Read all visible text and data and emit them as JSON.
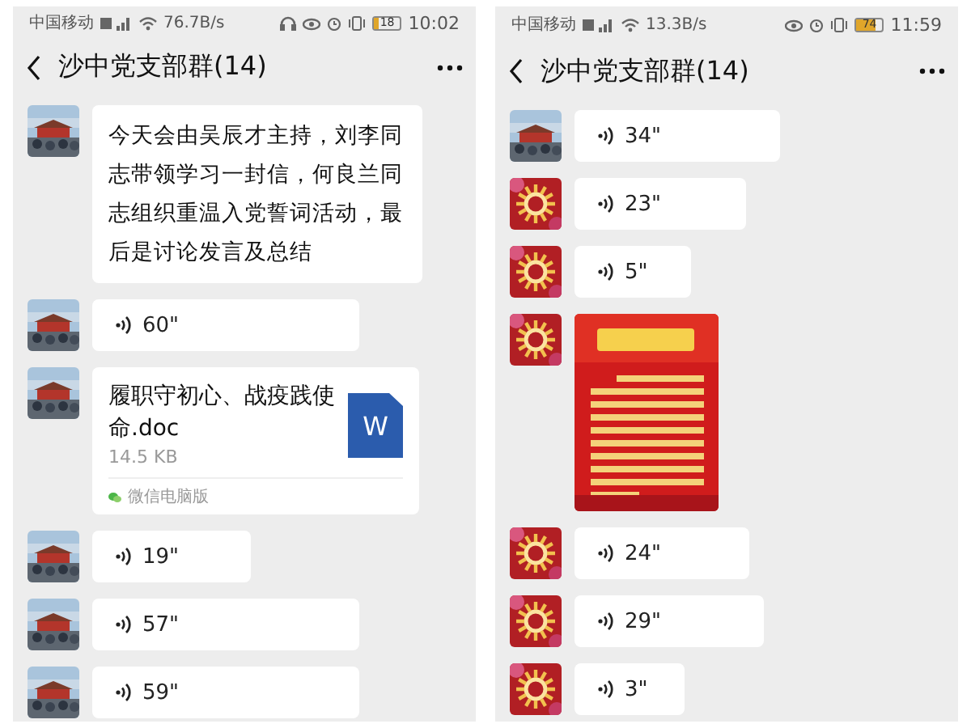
{
  "phones": [
    {
      "status_bar": {
        "carrier": "中国移动",
        "speed": "76.7B/s",
        "headset": true,
        "battery": "18",
        "time": "10:02"
      },
      "header": {
        "title": "沙中党支部群(14)"
      },
      "messages": [
        {
          "kind": "text",
          "avatar": {
            "kind": "gate"
          },
          "text": "今天会由吴辰才主持，刘李同志带领学习一封信，何良兰同志组织重温入党誓词活动，最后是讨论发言及总结"
        },
        {
          "kind": "voice",
          "avatar": {
            "kind": "gate"
          },
          "duration": "60\""
        },
        {
          "kind": "file",
          "avatar": {
            "kind": "gate"
          },
          "name": "履职守初心、战疫践使命.doc",
          "size": "14.5 KB",
          "icon_letter": "W",
          "source": "微信电脑版"
        },
        {
          "kind": "voice",
          "avatar": {
            "kind": "gate"
          },
          "duration": "19\""
        },
        {
          "kind": "voice",
          "avatar": {
            "kind": "gate"
          },
          "duration": "57\""
        },
        {
          "kind": "voice",
          "avatar": {
            "kind": "gate"
          },
          "duration": "59\""
        }
      ]
    },
    {
      "status_bar": {
        "carrier": "中国移动",
        "speed": "13.3B/s",
        "headset": false,
        "battery": "74",
        "time": "11:59"
      },
      "header": {
        "title": "沙中党支部群(14)"
      },
      "messages": [
        {
          "kind": "voice",
          "avatar": {
            "kind": "gate"
          },
          "duration": "34\""
        },
        {
          "kind": "voice",
          "avatar": {
            "kind": "emblem"
          },
          "duration": "23\""
        },
        {
          "kind": "voice",
          "avatar": {
            "kind": "emblem"
          },
          "duration": "5\""
        },
        {
          "avatar": {
            "kind": "emblem"
          }
        },
        {
          "kind": "voice",
          "avatar": {
            "kind": "emblem"
          },
          "duration": "24\""
        },
        {
          "kind": "voice",
          "avatar": {
            "kind": "emblem"
          },
          "duration": "29\""
        },
        {
          "kind": "voice",
          "avatar": {
            "kind": "emblem"
          },
          "duration": "3\""
        }
      ]
    }
  ]
}
